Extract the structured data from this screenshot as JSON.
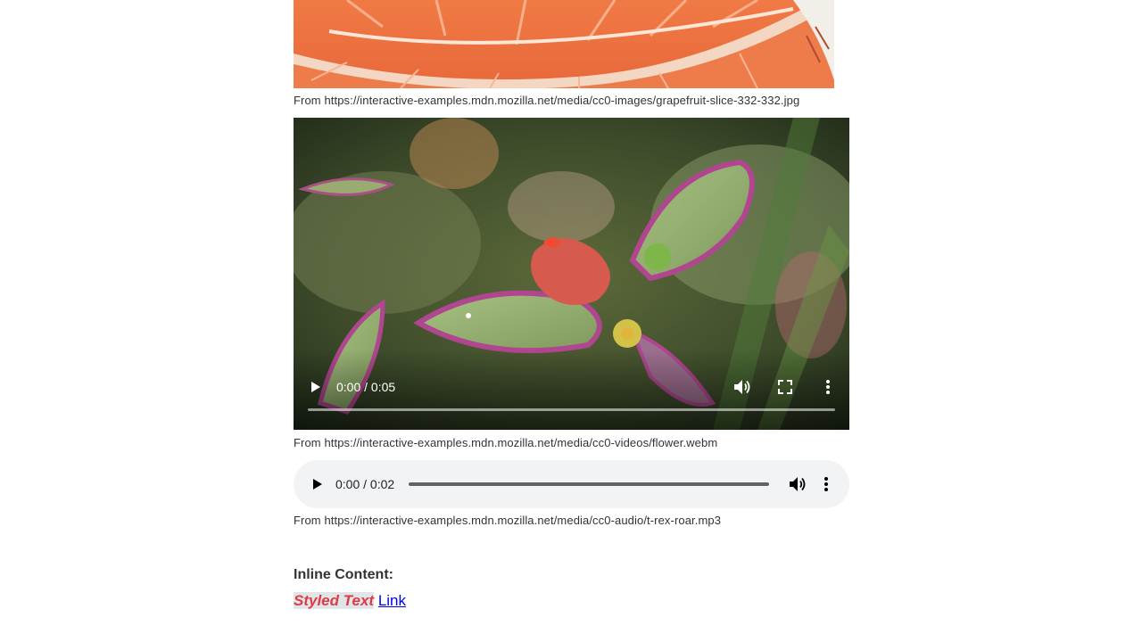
{
  "image": {
    "caption": "From https://interactive-examples.mdn.mozilla.net/media/cc0-images/grapefruit-slice-332-332.jpg"
  },
  "video": {
    "time": "0:00 / 0:05",
    "caption": "From https://interactive-examples.mdn.mozilla.net/media/cc0-videos/flower.webm",
    "icons": [
      "play-icon",
      "volume-icon",
      "fullscreen-icon",
      "more-options-icon"
    ]
  },
  "audio": {
    "time": "0:00 / 0:02",
    "caption": "From https://interactive-examples.mdn.mozilla.net/media/cc0-audio/t-rex-roar.mp3",
    "icons": [
      "play-icon",
      "volume-icon",
      "more-options-icon"
    ]
  },
  "inline": {
    "heading": "Inline Content:",
    "styled_text": "Styled Text",
    "link_text": "Link"
  },
  "colors": {
    "styled_text": "#e03a48",
    "styled_bg": "#dfe6e8",
    "link": "#0000ee",
    "audio_bg": "#f1f3f4"
  }
}
